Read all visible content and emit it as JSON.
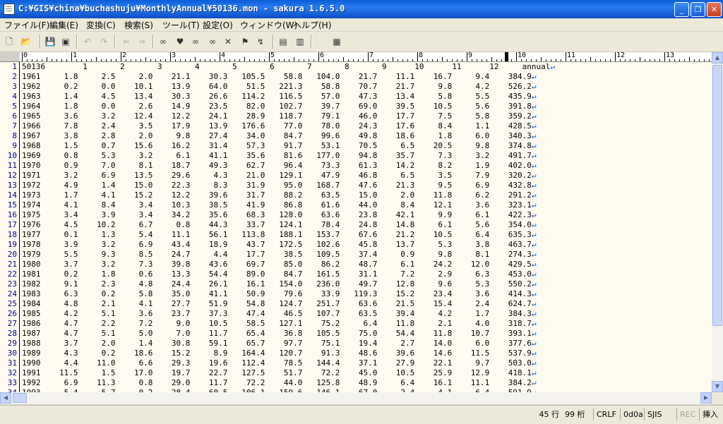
{
  "window": {
    "title": "C:¥GIS¥china¥buchashuju¥MonthlyAnnual¥50136.mon - sakura 1.6.5.0",
    "minimize": "_",
    "maximize": "❐",
    "close": "✕"
  },
  "menu": [
    "ファイル(F)",
    "編集(E)",
    "変換(C)",
    "検索(S)",
    "ツール(T)",
    "設定(O)",
    "ウィンドウ(W)",
    "ヘルプ(H)"
  ],
  "toolbar_icons": [
    "new-file-icon",
    "open-file-icon",
    "save-icon",
    "save-all-icon",
    "undo-icon",
    "redo-icon",
    "jump-back-icon",
    "jump-forward-icon",
    "search-icon",
    "search-prev-icon",
    "search-next-icon",
    "replace-icon",
    "mark-clear-icon",
    "grep-icon",
    "outline-icon",
    "compare-icon",
    "settings-icon"
  ],
  "ruler": {
    "labels": [
      "0",
      "1",
      "2",
      "3",
      "4",
      "5",
      "6",
      "7",
      "8",
      "9",
      "10",
      "11",
      "12",
      "13"
    ]
  },
  "editor": {
    "eol_glyph": "↵",
    "header": "50136        1       2       3       4       5       6       7       8       9      10      11      12     annual",
    "rows": [
      [
        "1961",
        "1.8",
        "2.5",
        "2.0",
        "21.1",
        "30.3",
        "105.5",
        "58.8",
        "104.0",
        "21.7",
        "11.1",
        "16.7",
        "9.4",
        "384.9"
      ],
      [
        "1962",
        "0.2",
        "0.0",
        "10.1",
        "13.9",
        "64.0",
        "51.5",
        "221.3",
        "58.8",
        "70.7",
        "21.7",
        "9.8",
        "4.2",
        "526.2"
      ],
      [
        "1963",
        "1.4",
        "4.5",
        "13.4",
        "30.3",
        "26.6",
        "114.2",
        "116.5",
        "57.0",
        "47.3",
        "13.4",
        "5.8",
        "5.5",
        "435.9"
      ],
      [
        "1964",
        "1.8",
        "0.0",
        "2.6",
        "14.9",
        "23.5",
        "82.0",
        "102.7",
        "39.7",
        "69.0",
        "39.5",
        "10.5",
        "5.6",
        "391.8"
      ],
      [
        "1965",
        "3.6",
        "3.2",
        "12.4",
        "12.2",
        "24.1",
        "28.9",
        "118.7",
        "79.1",
        "46.0",
        "17.7",
        "7.5",
        "5.8",
        "359.2"
      ],
      [
        "1966",
        "7.8",
        "2.4",
        "3.5",
        "17.9",
        "13.9",
        "176.6",
        "77.0",
        "78.0",
        "24.3",
        "17.6",
        "8.4",
        "1.1",
        "428.5"
      ],
      [
        "1967",
        "3.8",
        "2.8",
        "2.0",
        "9.8",
        "27.4",
        "34.0",
        "84.7",
        "99.6",
        "49.8",
        "18.6",
        "1.8",
        "6.0",
        "340.3"
      ],
      [
        "1968",
        "1.5",
        "0.7",
        "15.6",
        "16.2",
        "31.4",
        "57.3",
        "91.7",
        "53.1",
        "70.5",
        "6.5",
        "20.5",
        "9.8",
        "374.8"
      ],
      [
        "1969",
        "0.8",
        "5.3",
        "3.2",
        "6.1",
        "41.1",
        "35.6",
        "81.6",
        "177.0",
        "94.8",
        "35.7",
        "7.3",
        "3.2",
        "491.7"
      ],
      [
        "1970",
        "0.9",
        "7.0",
        "8.1",
        "18.7",
        "49.3",
        "62.7",
        "96.4",
        "73.3",
        "61.3",
        "14.2",
        "8.2",
        "1.9",
        "402.0"
      ],
      [
        "1971",
        "3.2",
        "6.9",
        "13.5",
        "29.6",
        "4.3",
        "21.0",
        "129.1",
        "47.9",
        "46.8",
        "6.5",
        "3.5",
        "7.9",
        "320.2"
      ],
      [
        "1972",
        "4.9",
        "1.4",
        "15.0",
        "22.3",
        "8.3",
        "31.9",
        "95.0",
        "168.7",
        "47.6",
        "21.3",
        "9.5",
        "6.9",
        "432.8"
      ],
      [
        "1973",
        "1.7",
        "4.1",
        "15.2",
        "12.2",
        "39.6",
        "31.7",
        "88.2",
        "63.5",
        "15.0",
        "2.0",
        "11.8",
        "6.2",
        "291.2"
      ],
      [
        "1974",
        "4.1",
        "8.4",
        "3.4",
        "10.3",
        "38.5",
        "41.9",
        "86.8",
        "61.6",
        "44.0",
        "8.4",
        "12.1",
        "3.6",
        "323.1"
      ],
      [
        "1975",
        "3.4",
        "3.9",
        "3.4",
        "34.2",
        "35.6",
        "68.3",
        "128.0",
        "63.6",
        "23.8",
        "42.1",
        "9.9",
        "6.1",
        "422.3"
      ],
      [
        "1976",
        "4.5",
        "10.2",
        "6.7",
        "0.8",
        "44.3",
        "33.7",
        "124.1",
        "78.4",
        "24.8",
        "14.8",
        "6.1",
        "5.6",
        "354.0"
      ],
      [
        "1977",
        "0.1",
        "1.3",
        "5.4",
        "11.1",
        "56.1",
        "113.8",
        "188.1",
        "153.7",
        "67.6",
        "21.2",
        "10.5",
        "6.4",
        "635.3"
      ],
      [
        "1978",
        "3.9",
        "3.2",
        "6.9",
        "43.4",
        "18.9",
        "43.7",
        "172.5",
        "102.6",
        "45.8",
        "13.7",
        "5.3",
        "3.8",
        "463.7"
      ],
      [
        "1979",
        "5.5",
        "9.3",
        "8.5",
        "24.7",
        "4.4",
        "17.7",
        "38.5",
        "109.5",
        "37.4",
        "0.9",
        "9.8",
        "8.1",
        "274.3"
      ],
      [
        "1980",
        "3.7",
        "3.2",
        "7.3",
        "39.8",
        "43.6",
        "69.7",
        "85.0",
        "86.2",
        "48.7",
        "6.1",
        "24.2",
        "12.0",
        "429.5"
      ],
      [
        "1981",
        "0.2",
        "1.8",
        "0.6",
        "13.3",
        "54.4",
        "89.0",
        "84.7",
        "161.5",
        "31.1",
        "7.2",
        "2.9",
        "6.3",
        "453.0"
      ],
      [
        "1982",
        "9.1",
        "2.3",
        "4.8",
        "24.4",
        "26.1",
        "16.1",
        "154.0",
        "236.0",
        "49.7",
        "12.8",
        "9.6",
        "5.3",
        "550.2"
      ],
      [
        "1983",
        "6.3",
        "0.2",
        "5.8",
        "35.0",
        "41.1",
        "50.9",
        "79.6",
        "33.9",
        "119.3",
        "15.2",
        "23.4",
        "3.6",
        "414.3"
      ],
      [
        "1984",
        "4.8",
        "2.1",
        "4.1",
        "27.7",
        "51.9",
        "54.8",
        "124.7",
        "251.7",
        "63.6",
        "21.5",
        "15.4",
        "2.4",
        "624.7"
      ],
      [
        "1985",
        "4.2",
        "5.1",
        "3.6",
        "23.7",
        "37.3",
        "47.4",
        "46.5",
        "107.7",
        "63.5",
        "39.4",
        "4.2",
        "1.7",
        "384.3"
      ],
      [
        "1986",
        "4.7",
        "2.2",
        "7.2",
        "9.0",
        "10.5",
        "58.5",
        "127.1",
        "75.2",
        "6.4",
        "11.8",
        "2.1",
        "4.0",
        "318.7"
      ],
      [
        "1987",
        "4.7",
        "5.1",
        "5.0",
        "7.0",
        "11.7",
        "65.4",
        "36.8",
        "105.5",
        "75.0",
        "54.4",
        "11.8",
        "10.7",
        "393.1"
      ],
      [
        "1988",
        "3.7",
        "2.0",
        "1.4",
        "30.8",
        "59.1",
        "65.7",
        "97.7",
        "75.1",
        "19.4",
        "2.7",
        "14.0",
        "6.0",
        "377.6"
      ],
      [
        "1989",
        "4.3",
        "0.2",
        "18.6",
        "15.2",
        "8.9",
        "164.4",
        "120.7",
        "91.3",
        "48.6",
        "39.6",
        "14.6",
        "11.5",
        "537.9"
      ],
      [
        "1990",
        "4.4",
        "11.0",
        "6.6",
        "29.3",
        "19.6",
        "112.4",
        "78.5",
        "144.4",
        "37.1",
        "27.9",
        "22.1",
        "9.7",
        "503.0"
      ],
      [
        "1991",
        "11.5",
        "1.5",
        "17.0",
        "19.7",
        "22.7",
        "127.5",
        "51.7",
        "72.2",
        "45.0",
        "10.5",
        "25.9",
        "12.9",
        "418.1"
      ],
      [
        "1992",
        "6.9",
        "11.3",
        "0.8",
        "29.0",
        "11.7",
        "72.2",
        "44.0",
        "125.8",
        "48.9",
        "6.4",
        "16.1",
        "11.1",
        "384.2"
      ],
      [
        "1993",
        "5.4",
        "5.7",
        "0.2",
        "28.4",
        "60.5",
        "106.1",
        "159.6",
        "146.1",
        "67.0",
        "2.4",
        "4.1",
        "6.4",
        "591.9"
      ]
    ]
  },
  "status": {
    "line": "45 行",
    "column": "99 桁",
    "eol": "CRLF",
    "code": "0d0a",
    "encoding": "SJIS",
    "rec": "REC",
    "mode": "挿入"
  }
}
